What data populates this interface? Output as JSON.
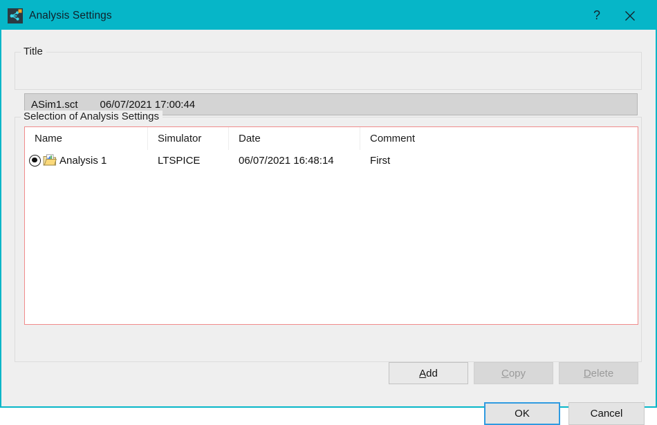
{
  "window": {
    "title": "Analysis Settings",
    "icon": "analysis-settings-icon",
    "help_label": "?",
    "close_label": "×",
    "accent_color": "#06b6c8"
  },
  "title_group": {
    "legend": "Title",
    "file_name": "ASim1.sct",
    "timestamp": "06/07/2021 17:00:44"
  },
  "selection_group": {
    "legend": "Selection of Analysis Settings",
    "list": {
      "border_color": "#f08a8a",
      "columns": [
        "Name",
        "Simulator",
        "Date",
        "Comment"
      ],
      "rows": [
        {
          "selected": true,
          "icon": "analysis-folder-icon",
          "name": "Analysis 1",
          "simulator": "LTSPICE",
          "date": "06/07/2021 16:48:14",
          "comment": "First"
        }
      ]
    },
    "buttons": [
      {
        "id": "add",
        "accel": "A",
        "rest": "dd",
        "enabled": true
      },
      {
        "id": "copy",
        "accel": "C",
        "rest": "opy",
        "enabled": false
      },
      {
        "id": "delete",
        "accel": "D",
        "rest": "elete",
        "enabled": false
      }
    ]
  },
  "dialog_buttons": {
    "ok": "OK",
    "cancel": "Cancel",
    "focus_color": "#2f9ae0"
  }
}
